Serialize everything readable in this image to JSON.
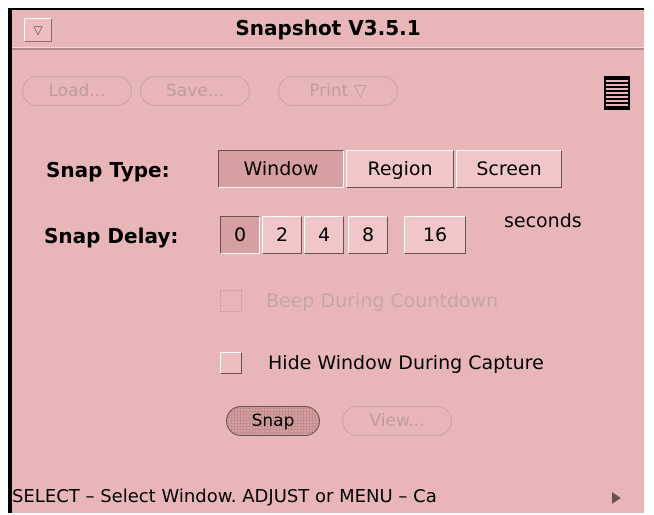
{
  "window": {
    "title": "Snapshot V3.5.1",
    "menu_glyph": "▽"
  },
  "toolbar": {
    "load_label": "Load...",
    "save_label": "Save...",
    "print_label": "Print ▽"
  },
  "snap_type": {
    "label": "Snap Type:",
    "options": [
      "Window",
      "Region",
      "Screen"
    ],
    "selected": "Window"
  },
  "snap_delay": {
    "label": "Snap Delay:",
    "options": [
      "0",
      "2",
      "4",
      "8",
      "16"
    ],
    "selected": "0",
    "unit": "seconds"
  },
  "options": {
    "beep_label": "Beep During Countdown",
    "beep_enabled": false,
    "hide_label": "Hide Window During Capture",
    "hide_checked": false
  },
  "actions": {
    "snap_label": "Snap",
    "view_label": "View..."
  },
  "status": {
    "text": "SELECT – Select Window.  ADJUST or MENU – Ca"
  }
}
